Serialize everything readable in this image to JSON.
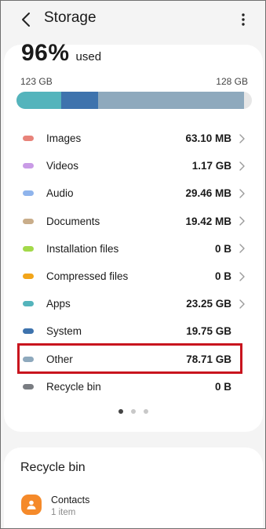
{
  "header": {
    "title": "Storage"
  },
  "summary": {
    "percent_used": "96%",
    "used_label": "used",
    "used_amount": "123 GB",
    "total_amount": "128 GB"
  },
  "usage_bar": {
    "track_color": "#e6e6e6",
    "segments": [
      {
        "name": "Apps",
        "fraction": 0.19,
        "color": "#54b4bc"
      },
      {
        "name": "System",
        "fraction": 0.155,
        "color": "#3e73ad"
      },
      {
        "name": "Other",
        "fraction": 0.62,
        "color": "#8ea9bd"
      }
    ]
  },
  "categories": [
    {
      "label": "Images",
      "size": "63.10 MB",
      "color": "#e8837a",
      "has_chevron": true
    },
    {
      "label": "Videos",
      "size": "1.17 GB",
      "color": "#c99be6",
      "has_chevron": true
    },
    {
      "label": "Audio",
      "size": "29.46 MB",
      "color": "#8fb4ec",
      "has_chevron": true
    },
    {
      "label": "Documents",
      "size": "19.42 MB",
      "color": "#c9ad8a",
      "has_chevron": true
    },
    {
      "label": "Installation files",
      "size": "0 B",
      "color": "#a3d94a",
      "has_chevron": true
    },
    {
      "label": "Compressed files",
      "size": "0 B",
      "color": "#f2a51a",
      "has_chevron": true
    },
    {
      "label": "Apps",
      "size": "23.25 GB",
      "color": "#54b4bc",
      "has_chevron": true
    },
    {
      "label": "System",
      "size": "19.75 GB",
      "color": "#3e73ad",
      "has_chevron": false
    },
    {
      "label": "Other",
      "size": "78.71 GB",
      "color": "#8ea9bd",
      "has_chevron": false
    },
    {
      "label": "Recycle bin",
      "size": "0 B",
      "color": "#7a7d82",
      "has_chevron": false
    }
  ],
  "highlight": {
    "target": "Other",
    "color": "#c8141e"
  },
  "pager": {
    "count": 3,
    "active": 0
  },
  "recycle_bin": {
    "title": "Recycle bin",
    "items": [
      {
        "label": "Contacts",
        "sub": "1 item",
        "icon": "person-icon",
        "color": "#f58a2a"
      }
    ]
  }
}
